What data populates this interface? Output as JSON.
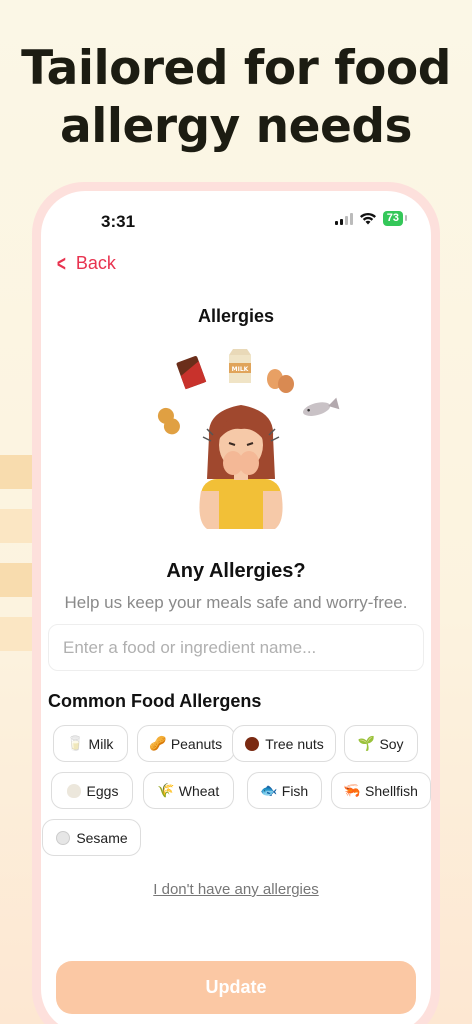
{
  "headline": {
    "line1": "Tailored for food",
    "line2": "allergy needs"
  },
  "status_bar": {
    "time": "3:31",
    "battery": "73"
  },
  "nav": {
    "back_label": "Back"
  },
  "page": {
    "title": "Allergies",
    "question": "Any Allergies?",
    "subtitle": "Help us keep your meals safe and worry-free."
  },
  "search": {
    "placeholder": "Enter a food or ingredient name...",
    "value": ""
  },
  "allergens": {
    "title": "Common Food Allergens",
    "items": [
      {
        "label": "Milk",
        "icon": "milk-glass-icon"
      },
      {
        "label": "Peanuts",
        "icon": "peanut-icon"
      },
      {
        "label": "Tree nuts",
        "icon": "chestnut-icon"
      },
      {
        "label": "Soy",
        "icon": "seedling-icon"
      },
      {
        "label": "Eggs",
        "icon": "egg-icon"
      },
      {
        "label": "Wheat",
        "icon": "wheat-icon"
      },
      {
        "label": "Fish",
        "icon": "fish-icon"
      },
      {
        "label": "Shellfish",
        "icon": "shrimp-icon"
      },
      {
        "label": "Sesame",
        "icon": "sesame-icon"
      }
    ]
  },
  "no_allergies_link": "I don't have any allergies",
  "update_button": "Update",
  "colors": {
    "accent": "#e8334f",
    "button": "#fbc8a4",
    "phone_frame": "#fde0dc"
  }
}
